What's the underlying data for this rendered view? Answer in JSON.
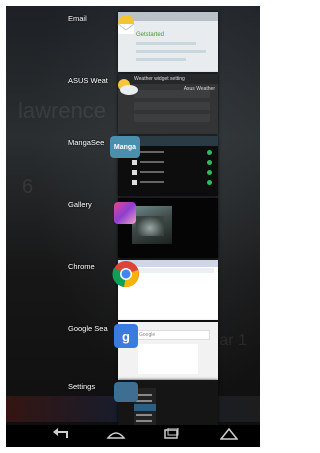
{
  "recent_apps": [
    {
      "name": "Email",
      "icon": "email-icon",
      "thumb_text": "Getstarted"
    },
    {
      "name": "ASUS Weat",
      "icon": "weather-icon",
      "thumb_header": "Weather widget setting",
      "thumb_header_right": "Asus Weather"
    },
    {
      "name": "MangaSee",
      "icon": "mangasee-icon",
      "icon_text": "Manga"
    },
    {
      "name": "Gallery",
      "icon": "gallery-icon"
    },
    {
      "name": "Chrome",
      "icon": "chrome-icon"
    },
    {
      "name": "Google Sea",
      "icon": "google-search-icon",
      "thumb_search": "Google"
    },
    {
      "name": "Settings",
      "icon": "settings-icon"
    }
  ],
  "wallpaper_text": [
    "lawrence",
    "6",
    "Mar 1"
  ],
  "navigation": {
    "back": "back-icon",
    "home": "home-icon",
    "recents": "recents-icon",
    "menu": "menu-icon"
  },
  "colors": {
    "chrome_red": "#db4437",
    "chrome_yellow": "#f4b400",
    "chrome_green": "#0f9d58",
    "chrome_blue": "#4285f4"
  }
}
